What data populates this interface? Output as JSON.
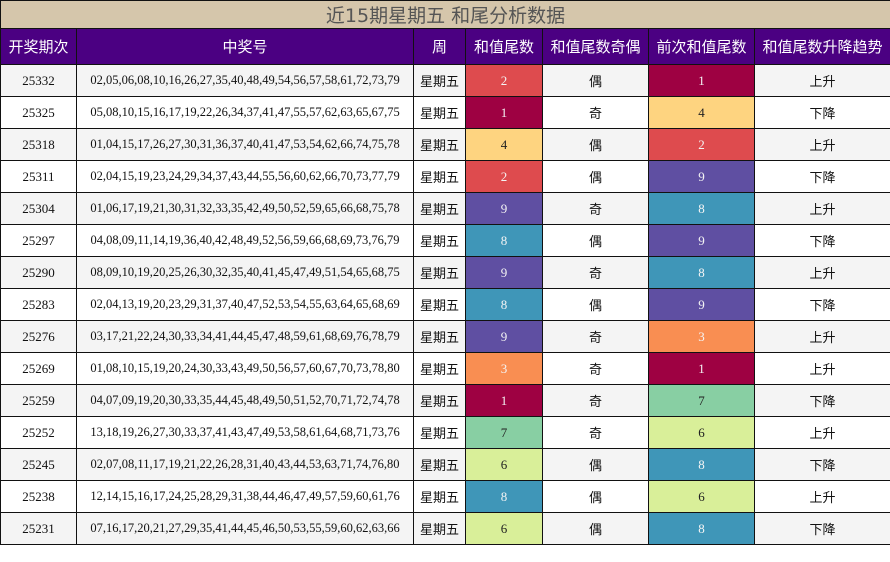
{
  "title": "近15期星期五 和尾分析数据",
  "headers": [
    "开奖期次",
    "中奖号",
    "周",
    "和值尾数",
    "和值尾数奇偶",
    "前次和值尾数",
    "和值尾数升降趋势"
  ],
  "tail_colors": {
    "1": "#9e0142",
    "2": "#de4b4e",
    "3": "#f98e52",
    "4": "#fed480",
    "6": "#d9ef99",
    "7": "#88cfa3",
    "8": "#3f96b8",
    "9": "#5f4fa2"
  },
  "rows": [
    {
      "period": "25332",
      "numbers": "02,05,06,08,10,16,26,27,35,40,48,49,54,56,57,58,61,72,73,79",
      "week": "星期五",
      "tail": "2",
      "parity": "偶",
      "prev": "1",
      "trend": "上升"
    },
    {
      "period": "25325",
      "numbers": "05,08,10,15,16,17,19,22,26,34,37,41,47,55,57,62,63,65,67,75",
      "week": "星期五",
      "tail": "1",
      "parity": "奇",
      "prev": "4",
      "trend": "下降"
    },
    {
      "period": "25318",
      "numbers": "01,04,15,17,26,27,30,31,36,37,40,41,47,53,54,62,66,74,75,78",
      "week": "星期五",
      "tail": "4",
      "parity": "偶",
      "prev": "2",
      "trend": "上升"
    },
    {
      "period": "25311",
      "numbers": "02,04,15,19,23,24,29,34,37,43,44,55,56,60,62,66,70,73,77,79",
      "week": "星期五",
      "tail": "2",
      "parity": "偶",
      "prev": "9",
      "trend": "下降"
    },
    {
      "period": "25304",
      "numbers": "01,06,17,19,21,30,31,32,33,35,42,49,50,52,59,65,66,68,75,78",
      "week": "星期五",
      "tail": "9",
      "parity": "奇",
      "prev": "8",
      "trend": "上升"
    },
    {
      "period": "25297",
      "numbers": "04,08,09,11,14,19,36,40,42,48,49,52,56,59,66,68,69,73,76,79",
      "week": "星期五",
      "tail": "8",
      "parity": "偶",
      "prev": "9",
      "trend": "下降"
    },
    {
      "period": "25290",
      "numbers": "08,09,10,19,20,25,26,30,32,35,40,41,45,47,49,51,54,65,68,75",
      "week": "星期五",
      "tail": "9",
      "parity": "奇",
      "prev": "8",
      "trend": "上升"
    },
    {
      "period": "25283",
      "numbers": "02,04,13,19,20,23,29,31,37,40,47,52,53,54,55,63,64,65,68,69",
      "week": "星期五",
      "tail": "8",
      "parity": "偶",
      "prev": "9",
      "trend": "下降"
    },
    {
      "period": "25276",
      "numbers": "03,17,21,22,24,30,33,34,41,44,45,47,48,59,61,68,69,76,78,79",
      "week": "星期五",
      "tail": "9",
      "parity": "奇",
      "prev": "3",
      "trend": "上升"
    },
    {
      "period": "25269",
      "numbers": "01,08,10,15,19,20,24,30,33,43,49,50,56,57,60,67,70,73,78,80",
      "week": "星期五",
      "tail": "3",
      "parity": "奇",
      "prev": "1",
      "trend": "上升"
    },
    {
      "period": "25259",
      "numbers": "04,07,09,19,20,30,33,35,44,45,48,49,50,51,52,70,71,72,74,78",
      "week": "星期五",
      "tail": "1",
      "parity": "奇",
      "prev": "7",
      "trend": "下降"
    },
    {
      "period": "25252",
      "numbers": "13,18,19,26,27,30,33,37,41,43,47,49,53,58,61,64,68,71,73,76",
      "week": "星期五",
      "tail": "7",
      "parity": "奇",
      "prev": "6",
      "trend": "上升"
    },
    {
      "period": "25245",
      "numbers": "02,07,08,11,17,19,21,22,26,28,31,40,43,44,53,63,71,74,76,80",
      "week": "星期五",
      "tail": "6",
      "parity": "偶",
      "prev": "8",
      "trend": "下降"
    },
    {
      "period": "25238",
      "numbers": "12,14,15,16,17,24,25,28,29,31,38,44,46,47,49,57,59,60,61,76",
      "week": "星期五",
      "tail": "8",
      "parity": "偶",
      "prev": "6",
      "trend": "上升"
    },
    {
      "period": "25231",
      "numbers": "07,16,17,20,21,27,29,35,41,44,45,46,50,53,55,59,60,62,63,66",
      "week": "星期五",
      "tail": "6",
      "parity": "偶",
      "prev": "8",
      "trend": "下降"
    }
  ]
}
